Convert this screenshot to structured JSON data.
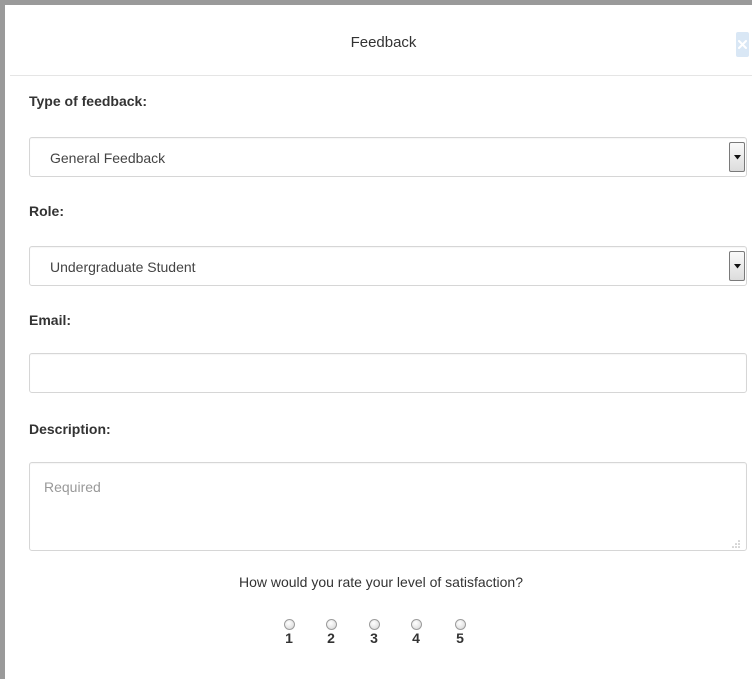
{
  "dialog": {
    "title": "Feedback",
    "close_icon": "close-icon"
  },
  "form": {
    "type_label": "Type of feedback:",
    "type_value": "General Feedback",
    "role_label": "Role:",
    "role_value": "Undergraduate Student",
    "email_label": "Email:",
    "email_value": "",
    "description_label": "Description:",
    "description_placeholder": "Required"
  },
  "rating": {
    "question": "How would you rate your level of satisfaction?",
    "options": [
      "1",
      "2",
      "3",
      "4",
      "5"
    ],
    "selected": null
  },
  "colors": {
    "close_button_bg": "#d9e7f5",
    "border": "#d6d6d6",
    "frame": "#9a9a9a"
  }
}
